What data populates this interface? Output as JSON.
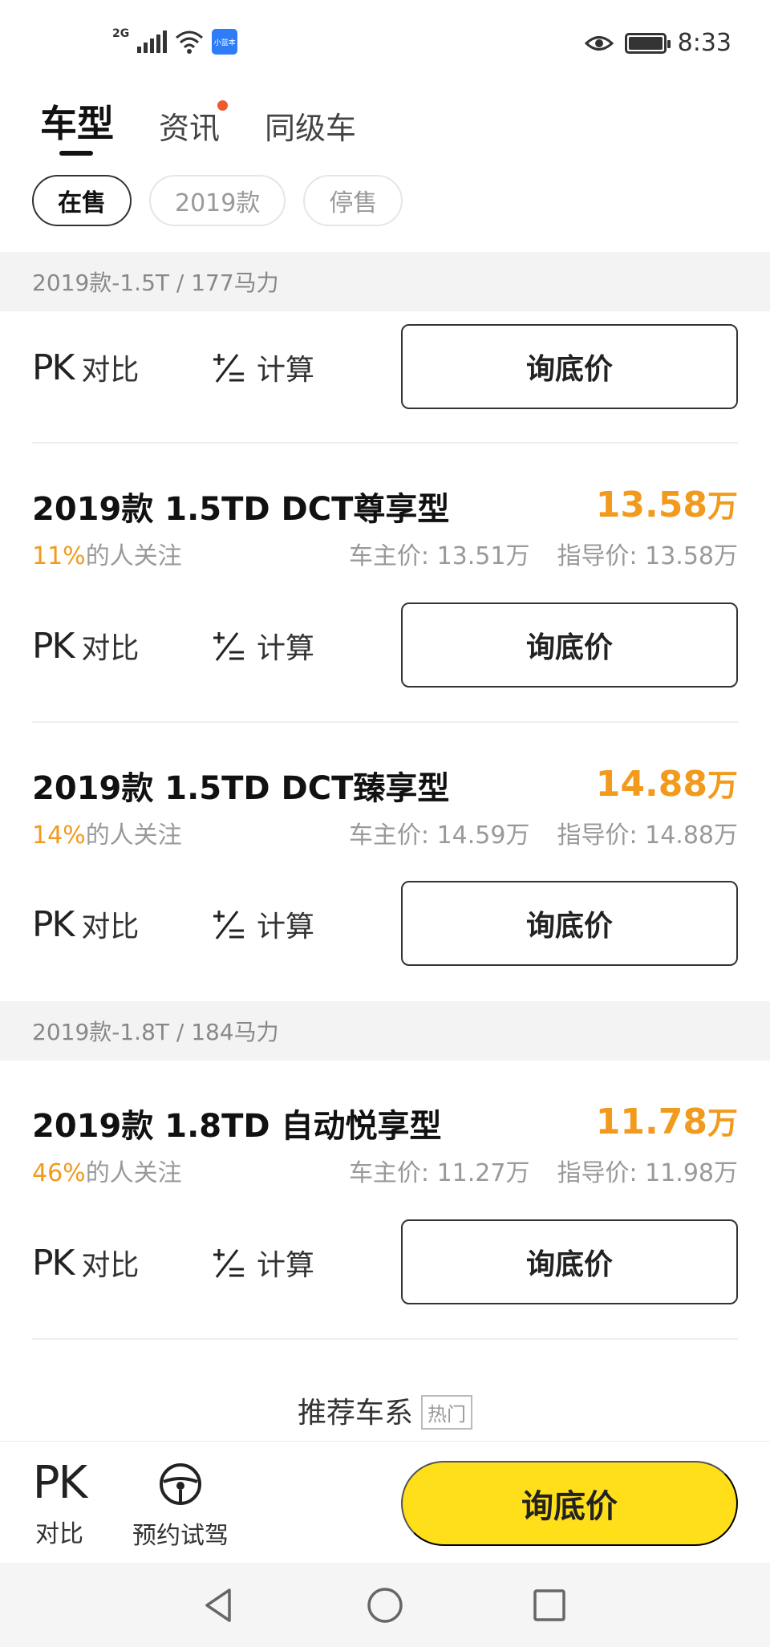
{
  "status_bar": {
    "network": "2G",
    "app_badge": "小蓝本",
    "time": "8:33",
    "icons": [
      "signal-icon",
      "wifi-icon",
      "eye-icon",
      "battery-icon"
    ]
  },
  "tabs": [
    {
      "label": "车型",
      "active": true
    },
    {
      "label": "资讯",
      "has_dot": true
    },
    {
      "label": "同级车"
    }
  ],
  "filters": [
    {
      "label": "在售",
      "active": true
    },
    {
      "label": "2019款"
    },
    {
      "label": "停售"
    }
  ],
  "actions": {
    "pk_mark": "PK",
    "pk_label": "对比",
    "calc_label": "计算",
    "ask_label": "询底价"
  },
  "groups": [
    {
      "header": "2019款-1.5T / 177马力",
      "models": [
        {
          "name": "2019款 1.5TD DCT尊享型",
          "price": "13.58",
          "price_unit": "万",
          "attention_pct": "11%",
          "attention_text": "的人关注",
          "owner_price": "车主价: 13.51万",
          "guide_price": "指导价: 13.58万"
        },
        {
          "name": "2019款 1.5TD DCT臻享型",
          "price": "14.88",
          "price_unit": "万",
          "attention_pct": "14%",
          "attention_text": "的人关注",
          "owner_price": "车主价: 14.59万",
          "guide_price": "指导价: 14.88万"
        }
      ]
    },
    {
      "header": "2019款-1.8T / 184马力",
      "models": [
        {
          "name": "2019款 1.8TD 自动悦享型",
          "price": "11.78",
          "price_unit": "万",
          "attention_pct": "46%",
          "attention_text": "的人关注",
          "owner_price": "车主价: 11.27万",
          "guide_price": "指导价: 11.98万"
        }
      ]
    }
  ],
  "recommend": {
    "title": "推荐车系",
    "tag": "热门"
  },
  "bottom_bar": {
    "pk_mark": "PK",
    "pk_label": "对比",
    "drive_label": "预约试驾",
    "ask_label": "询底价"
  },
  "colors": {
    "accent_orange": "#f29a1d",
    "button_yellow": "#ffde1a",
    "dot_red": "#ef5a2d"
  }
}
